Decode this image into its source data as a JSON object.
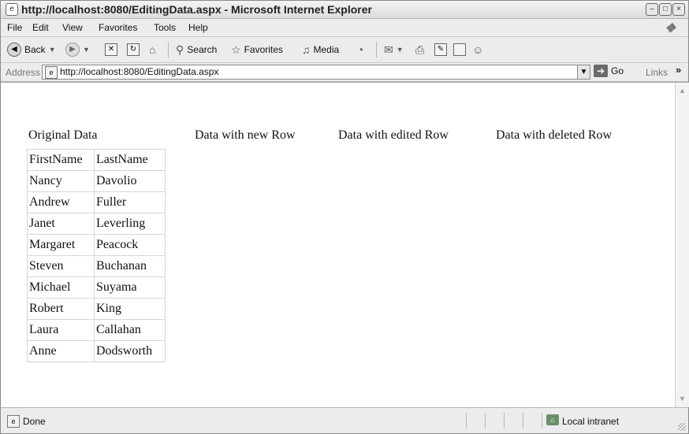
{
  "window": {
    "title": "http://localhost:8080/EditingData.aspx - Microsoft Internet Explorer",
    "buttons": {
      "minimize": "–",
      "maximize": "□",
      "close": "×"
    }
  },
  "menu": [
    "File",
    "Edit",
    "View",
    "Favorites",
    "Tools",
    "Help"
  ],
  "toolbar": {
    "back_label": "Back",
    "search_label": "Search",
    "favorites_label": "Favorites",
    "media_label": "Media"
  },
  "address": {
    "label": "Address",
    "url": "http://localhost:8080/EditingData.aspx",
    "go_label": "Go",
    "links_label": "Links"
  },
  "page": {
    "headings": {
      "original": "Original Data",
      "new_row": "Data with new Row",
      "edited_row": "Data with edited Row",
      "deleted_row": "Data with deleted Row"
    },
    "table": {
      "headers": [
        "FirstName",
        "LastName"
      ],
      "rows": [
        [
          "Nancy",
          "Davolio"
        ],
        [
          "Andrew",
          "Fuller"
        ],
        [
          "Janet",
          "Leverling"
        ],
        [
          "Margaret",
          "Peacock"
        ],
        [
          "Steven",
          "Buchanan"
        ],
        [
          "Michael",
          "Suyama"
        ],
        [
          "Robert",
          "King"
        ],
        [
          "Laura",
          "Callahan"
        ],
        [
          "Anne",
          "Dodsworth"
        ]
      ]
    }
  },
  "status": {
    "text": "Done",
    "zone": "Local intranet"
  },
  "colors": {
    "chrome": "#ececec",
    "content_bg": "#ffffff",
    "table_border": "#d6d6d6"
  }
}
